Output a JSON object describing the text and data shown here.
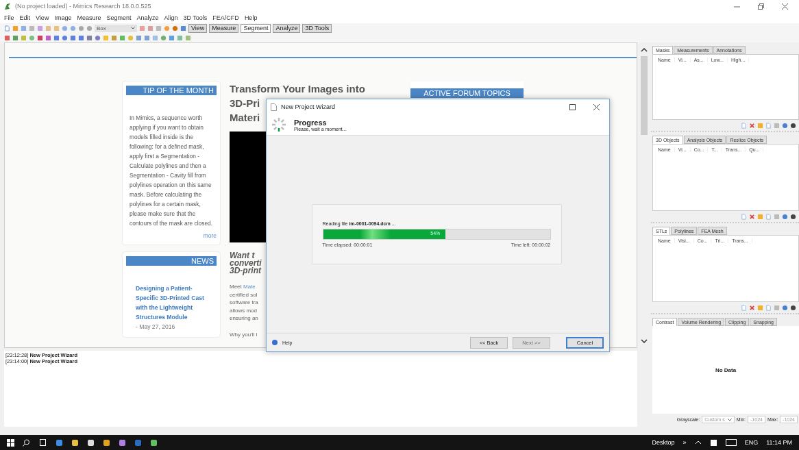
{
  "window": {
    "title": "(No project loaded) - Mimics Research 18.0.0.525"
  },
  "menu": [
    "File",
    "Edit",
    "View",
    "Image",
    "Measure",
    "Segment",
    "Analyze",
    "Align",
    "3D Tools",
    "FEA/CFD",
    "Help"
  ],
  "toolbar": {
    "select": "Box",
    "tabs": [
      {
        "label": "View",
        "selected": false
      },
      {
        "label": "Measure",
        "selected": false
      },
      {
        "label": "Segment",
        "selected": true
      },
      {
        "label": "Analyze",
        "selected": false
      },
      {
        "label": "3D Tools",
        "selected": false
      }
    ]
  },
  "web_page": {
    "tip": {
      "heading": "TIP OF THE MONTH",
      "body": "In Mimics, a sequence worth applying if you want to obtain models filled inside is the following: for a defined mask, apply first a Segmentation - Calculate polylines and then a Segmentation - Cavity fill from polylines operation on this same mask. Before calculating the polylines for a certain mask, please make sure that the contours of the mask are closed.",
      "more": "more"
    },
    "news": {
      "heading": "NEWS",
      "items": [
        {
          "title": "Designing a Patient-Specific 3D-Printed Cast with the Lightweight Structures Module",
          "date": " - May 27, 2016"
        }
      ]
    },
    "feature": {
      "title_lines": [
        "Transform Your Images into",
        "3D-Pri",
        "Materi"
      ],
      "subtitle_lines": [
        "Want t",
        "converti",
        "3D-print"
      ],
      "intro": "Meet",
      "link": "Mate",
      "body_lines": [
        "certified sol",
        "software tra",
        "allows mod",
        "ensuring an"
      ],
      "closing": "Why you'll l"
    },
    "forum": {
      "heading": "ACTIVE FORUM TOPICS"
    }
  },
  "dialog": {
    "title": "New Project Wizard",
    "heading": "Progress",
    "subheading": "Please, wait a moment...",
    "status": "Reading file **im-0001-0094.dcm** ...",
    "level": 0.54,
    "percent": "54%",
    "elapsed": "Time elapsed:  00:00:01",
    "remaining": "Time left:  00:00:02",
    "help": "Help",
    "buttons": [
      {
        "label": "<< Back",
        "disabled": false,
        "default": false
      },
      {
        "label": "Next >>",
        "disabled": true,
        "default": false
      },
      {
        "label": "Cancel",
        "disabled": false,
        "default": true
      }
    ]
  },
  "log": [
    "[23:12:28] **New Project Wizard**",
    "[23:14:00] **New Project Wizard**"
  ],
  "panels": [
    {
      "tabs": [
        {
          "label": "Masks",
          "selected": true
        },
        {
          "label": "Measurements",
          "selected": false
        },
        {
          "label": "Annotations",
          "selected": false
        }
      ],
      "columns": [
        "Name",
        "Vi...",
        "As...",
        "Low...",
        "High..."
      ]
    },
    {
      "tabs": [
        {
          "label": "3D Objects",
          "selected": true
        },
        {
          "label": "Analysis Objects",
          "selected": false
        },
        {
          "label": "Reslice Objects",
          "selected": false
        }
      ],
      "columns": [
        "Name",
        "Vi...",
        "Co...",
        "T...",
        "Trans...",
        "Qu..."
      ]
    },
    {
      "tabs": [
        {
          "label": "STLs",
          "selected": true
        },
        {
          "label": "Polylines",
          "selected": false
        },
        {
          "label": "FEA Mesh",
          "selected": false
        }
      ],
      "columns": [
        "Name",
        "Visi...",
        "Co...",
        "Tri...",
        "Trans..."
      ]
    }
  ],
  "contrast": {
    "tabs": [
      {
        "label": "Contrast",
        "selected": true
      },
      {
        "label": "Volume Rendering",
        "selected": false
      },
      {
        "label": "Clipping",
        "selected": false
      },
      {
        "label": "Snapping",
        "selected": false
      }
    ],
    "message": "No Data",
    "grayscale_label": "Grayscale:",
    "grayscale_value": "Custom s",
    "min_label": "Min:",
    "min_value": "-1024",
    "max_label": "Max:",
    "max_value": "-1024"
  },
  "taskbar": {
    "desktop": "Desktop",
    "overflow": "»",
    "language": "ENG",
    "time": "11:14 PM"
  }
}
